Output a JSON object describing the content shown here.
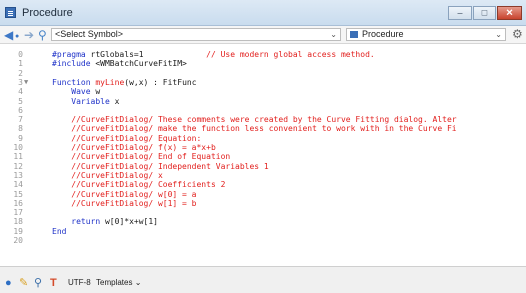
{
  "window": {
    "title": "Procedure"
  },
  "toolbar": {
    "symbol_select": "<Select Symbol>",
    "procedure_select": "Procedure"
  },
  "code_lines": [
    {
      "n": "0",
      "fold": "",
      "segs": [
        [
          "kw",
          "#pragma"
        ],
        [
          "pl",
          " rtGlobals=1"
        ],
        [
          "cm",
          "\t\t// Use modern global access method."
        ]
      ]
    },
    {
      "n": "1",
      "fold": "",
      "segs": [
        [
          "kw",
          "#include"
        ],
        [
          "pl",
          " <WMBatchCurveFitIM>"
        ]
      ]
    },
    {
      "n": "2",
      "fold": "",
      "segs": []
    },
    {
      "n": "3",
      "fold": "▼",
      "segs": [
        [
          "kw",
          "Function"
        ],
        [
          "pl",
          " "
        ],
        [
          "cm",
          "myLine"
        ],
        [
          "pl",
          "(w,x) : FitFunc"
        ]
      ]
    },
    {
      "n": "4",
      "fold": "",
      "segs": [
        [
          "pl",
          "    "
        ],
        [
          "kw",
          "Wave"
        ],
        [
          "pl",
          " w"
        ]
      ]
    },
    {
      "n": "5",
      "fold": "",
      "segs": [
        [
          "pl",
          "    "
        ],
        [
          "kw",
          "Variable"
        ],
        [
          "pl",
          " x"
        ]
      ]
    },
    {
      "n": "6",
      "fold": "",
      "segs": []
    },
    {
      "n": "7",
      "fold": "",
      "segs": [
        [
          "pl",
          "    "
        ],
        [
          "cm",
          "//CurveFitDialog/ These comments were created by the Curve Fitting dialog. Alter"
        ]
      ]
    },
    {
      "n": "8",
      "fold": "",
      "segs": [
        [
          "pl",
          "    "
        ],
        [
          "cm",
          "//CurveFitDialog/ make the function less convenient to work with in the Curve Fi"
        ]
      ]
    },
    {
      "n": "9",
      "fold": "",
      "segs": [
        [
          "pl",
          "    "
        ],
        [
          "cm",
          "//CurveFitDialog/ Equation:"
        ]
      ]
    },
    {
      "n": "10",
      "fold": "",
      "segs": [
        [
          "pl",
          "    "
        ],
        [
          "cm",
          "//CurveFitDialog/ f(x) = a*x+b"
        ]
      ]
    },
    {
      "n": "11",
      "fold": "",
      "segs": [
        [
          "pl",
          "    "
        ],
        [
          "cm",
          "//CurveFitDialog/ End of Equation"
        ]
      ]
    },
    {
      "n": "12",
      "fold": "",
      "segs": [
        [
          "pl",
          "    "
        ],
        [
          "cm",
          "//CurveFitDialog/ Independent Variables 1"
        ]
      ]
    },
    {
      "n": "13",
      "fold": "",
      "segs": [
        [
          "pl",
          "    "
        ],
        [
          "cm",
          "//CurveFitDialog/ x"
        ]
      ]
    },
    {
      "n": "14",
      "fold": "",
      "segs": [
        [
          "pl",
          "    "
        ],
        [
          "cm",
          "//CurveFitDialog/ Coefficients 2"
        ]
      ]
    },
    {
      "n": "15",
      "fold": "",
      "segs": [
        [
          "pl",
          "    "
        ],
        [
          "cm",
          "//CurveFitDialog/ w[0] = a"
        ]
      ]
    },
    {
      "n": "16",
      "fold": "",
      "segs": [
        [
          "pl",
          "    "
        ],
        [
          "cm",
          "//CurveFitDialog/ w[1] = b"
        ]
      ]
    },
    {
      "n": "17",
      "fold": "",
      "segs": []
    },
    {
      "n": "18",
      "fold": "",
      "segs": [
        [
          "pl",
          "    "
        ],
        [
          "kw",
          "return"
        ],
        [
          "pl",
          " w[0]*x+w[1]"
        ]
      ]
    },
    {
      "n": "19",
      "fold": "",
      "segs": [
        [
          "kw",
          "End"
        ]
      ]
    },
    {
      "n": "20",
      "fold": "",
      "segs": []
    }
  ],
  "status": {
    "encoding": "UTF-8",
    "templates": "Templates"
  },
  "colors": {
    "keyword": "#1f32c8",
    "comment": "#e2201e",
    "line_number": "#9a9a9a"
  }
}
